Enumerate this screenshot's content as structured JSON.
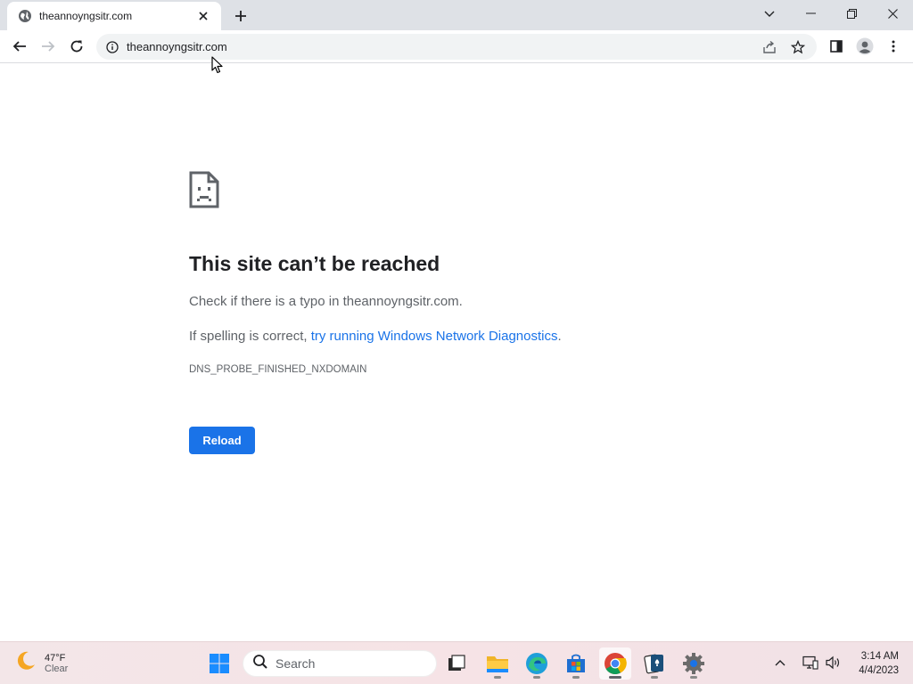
{
  "browser": {
    "tab": {
      "title": "theannoyngsitr.com"
    },
    "address": {
      "url": "theannoyngsitr.com"
    }
  },
  "error_page": {
    "title": "This site can’t be reached",
    "line1": "Check if there is a typo in theannoyngsitr.com.",
    "line2_prefix": "If spelling is correct, ",
    "line2_link": "try running Windows Network Diagnostics",
    "line2_suffix": ".",
    "error_code": "DNS_PROBE_FINISHED_NXDOMAIN",
    "reload_label": "Reload"
  },
  "taskbar": {
    "weather": {
      "temp": "47°F",
      "condition": "Clear"
    },
    "search_label": "Search",
    "clock": {
      "time": "3:14 AM",
      "date": "4/4/2023"
    }
  },
  "colors": {
    "accent": "#1a73e8",
    "tabstrip": "#dee1e6",
    "text_primary": "#202124",
    "text_secondary": "#5f6368"
  }
}
